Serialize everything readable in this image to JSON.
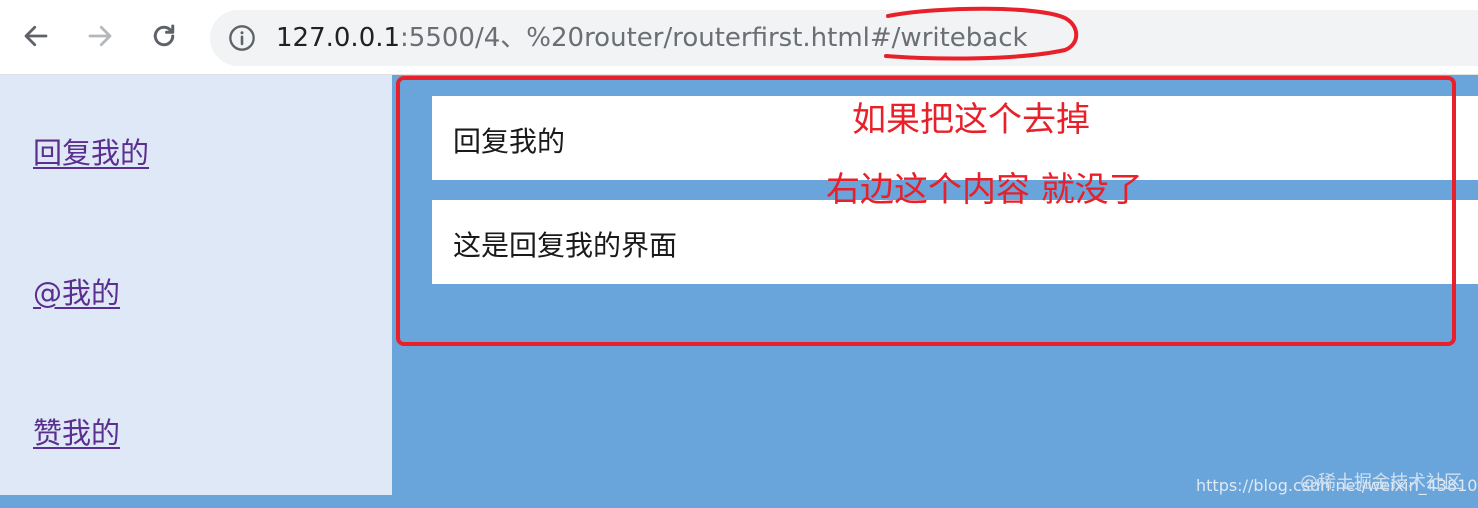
{
  "browser": {
    "url_host": "127.0.0.1",
    "url_rest": ":5500/4、%20router/routerfirst.html#/writeback"
  },
  "sidebar": {
    "links": [
      {
        "label": "回复我的"
      },
      {
        "label": "@我的"
      },
      {
        "label": "赞我的"
      }
    ]
  },
  "main": {
    "panels": [
      {
        "text": "回复我的"
      },
      {
        "text": "这是回复我的界面"
      }
    ]
  },
  "annotation": {
    "line1": "如果把这个去掉",
    "line2": "右边这个内容 就没了",
    "color": "#e8202a"
  },
  "watermark": {
    "url": "https://blog.csdn.net/weixin_43810",
    "brand": "@稀土掘金技术社区"
  },
  "colors": {
    "page_bg": "#69a4db",
    "sidebar_bg": "#dfe8f6",
    "link": "#5b2f8f"
  }
}
